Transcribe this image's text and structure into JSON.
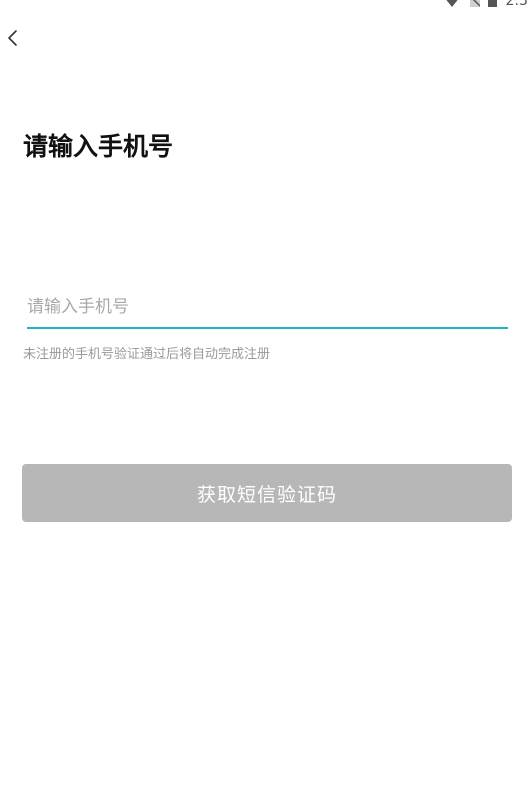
{
  "status_bar": {
    "time": "2:5",
    "icons": [
      "wifi-icon",
      "no-sim-icon",
      "battery-icon"
    ]
  },
  "nav": {
    "back_icon": "chevron-left-icon"
  },
  "page": {
    "title": "请输入手机号"
  },
  "form": {
    "phone_placeholder": "请输入手机号",
    "phone_value": "",
    "hint": "未注册的手机号验证通过后将自动完成注册",
    "submit_label": "获取短信验证码"
  },
  "colors": {
    "accent": "#1fb5c6",
    "button_disabled": "#b7b7b7",
    "hint": "#9a9a9a",
    "title": "#111111"
  }
}
